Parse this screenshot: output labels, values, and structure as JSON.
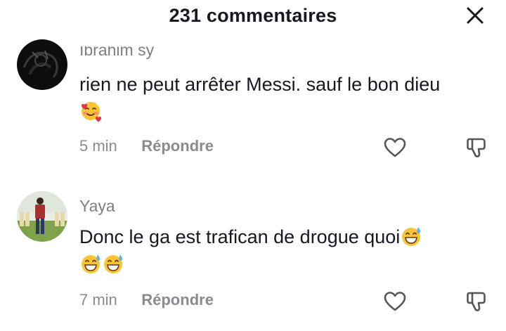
{
  "header": {
    "title": "231 commentaires"
  },
  "comments": [
    {
      "username": "Ibrahim sy",
      "text": "rien ne peut arrêter Messi. sauf le bon dieu",
      "emoji": [
        "smiling-face-with-hearts"
      ],
      "time": "5 min",
      "reply_label": "Répondre"
    },
    {
      "username": "Yaya",
      "text": "Donc le ga est trafican de drogue quoi",
      "emoji": [
        "grinning-face-with-sweat",
        "grinning-face-with-sweat",
        "grinning-face-with-sweat"
      ],
      "time": "7 min",
      "reply_label": "Répondre"
    }
  ],
  "colors": {
    "text": "#161823",
    "secondary": "#8a8b91"
  }
}
